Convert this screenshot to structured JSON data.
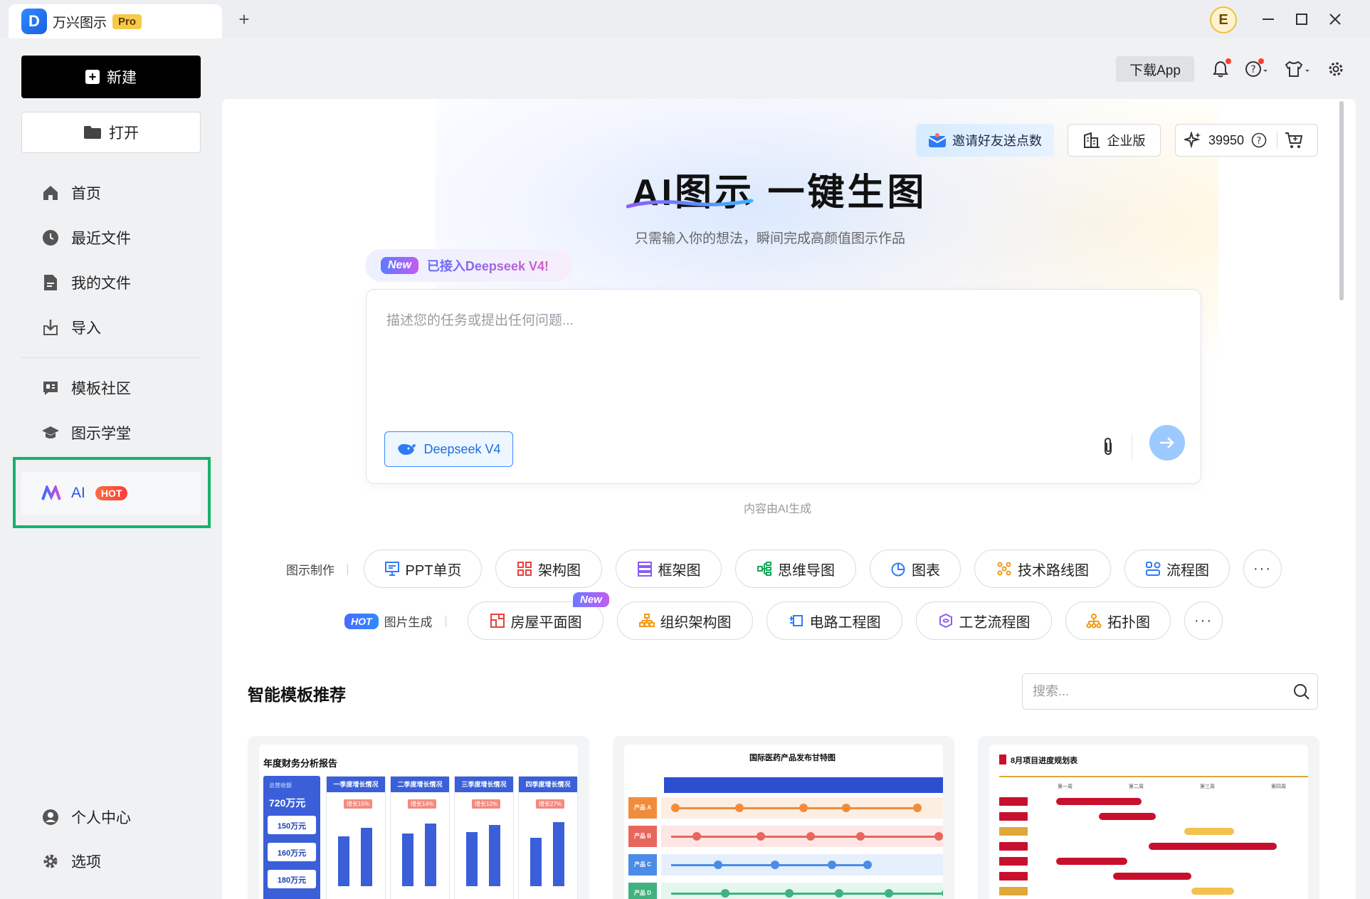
{
  "titlebar": {
    "app_logo_letter": "D",
    "app_name": "万兴图示",
    "pro_badge": "Pro",
    "new_tab_symbol": "+",
    "avatar_letter": "E"
  },
  "sidebar": {
    "new_button": "新建",
    "open_button": "打开",
    "nav": [
      {
        "label": "首页",
        "icon": "home-icon"
      },
      {
        "label": "最近文件",
        "icon": "clock-icon"
      },
      {
        "label": "我的文件",
        "icon": "file-icon"
      },
      {
        "label": "导入",
        "icon": "import-icon"
      },
      {
        "label": "模板社区",
        "icon": "community-icon"
      },
      {
        "label": "图示学堂",
        "icon": "graduation-cap-icon"
      }
    ],
    "ai_item": {
      "label": "AI",
      "badge": "HOT"
    },
    "bottom": [
      {
        "label": "个人中心",
        "icon": "user-icon"
      },
      {
        "label": "选项",
        "icon": "gear-icon"
      }
    ]
  },
  "topbar": {
    "download_app": "下载App",
    "icons": [
      "bell-icon",
      "help-icon",
      "shirt-icon",
      "settings-icon"
    ]
  },
  "hero": {
    "invite_button": "邀请好友送点数",
    "enterprise_button": "企业版",
    "credits": "39950",
    "title": "AI图示 一键生图",
    "subtitle": "只需输入你的想法，瞬间完成高颜值图示作品",
    "new_chip": "New",
    "deepseek_tag": "已接入Deepseek V4!",
    "prompt_placeholder": "描述您的任务或提出任何问题...",
    "model_button": "Deepseek V4",
    "ai_note": "内容由AI生成"
  },
  "chips_row1": {
    "label": "图示制作",
    "items": [
      "PPT单页",
      "架构图",
      "框架图",
      "思维导图",
      "图表",
      "技术路线图",
      "流程图"
    ]
  },
  "chips_row2": {
    "hot": "HOT",
    "label": "图片生成",
    "new_corner": "New",
    "items": [
      "房屋平面图",
      "组织架构图",
      "电路工程图",
      "工艺流程图",
      "拓扑图"
    ]
  },
  "more_symbol": "···",
  "templates": {
    "title": "智能模板推荐",
    "search_placeholder": "搜索...",
    "cards": [
      {
        "title": "年度财务分析报告",
        "total_label": "总营收额",
        "total": "720万元",
        "sub_values": [
          "150万元",
          "160万元",
          "180万元"
        ],
        "panels": [
          "一季度增长情况",
          "二季度增长情况",
          "三季度增长情况",
          "四季度增长情况"
        ],
        "tags": [
          "增长15%",
          "增长14%",
          "增长12%",
          "增长27%"
        ]
      },
      {
        "title": "国际医药产品发布甘特图",
        "rows": [
          "产品 A",
          "产品 B",
          "产品 C",
          "产品 D"
        ]
      },
      {
        "title": "8月项目进度规划表",
        "weeks": [
          "第一周",
          "第二周",
          "第三周",
          "第四周"
        ]
      }
    ]
  },
  "colors": {
    "accent": "#2a56e8",
    "highlight_border": "#17b26a",
    "hot": "#ff4d3a",
    "send": "#9cc9ff"
  }
}
